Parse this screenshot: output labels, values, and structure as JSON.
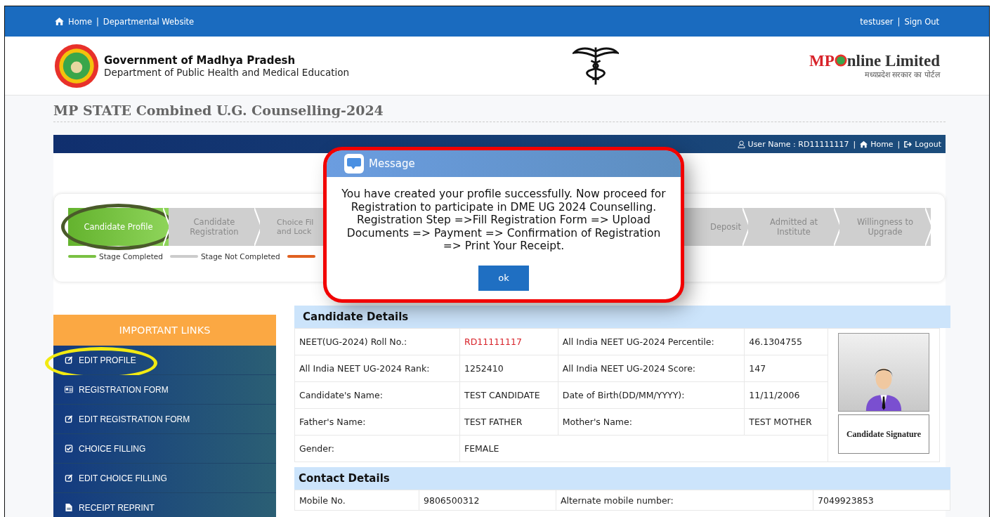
{
  "top_bar": {
    "left_links": [
      "Home",
      "Departmental Website"
    ],
    "right_links": [
      "testuser",
      "Sign Out"
    ],
    "separator": "|"
  },
  "header": {
    "org_name": "Government of Madhya Pradesh",
    "dept_name": "Department of Public Health and Medical Education",
    "brand": "MP",
    "brand_rest": "nline Limited",
    "brand_hindi": "मध्यप्रदेश सरकार का पोर्टल"
  },
  "page_title": "MP STATE Combined U.G. Counselling-2024",
  "user_bar": {
    "user_label": "User Name : RD11111117",
    "home": "Home",
    "logout": "Logout",
    "separator": "|"
  },
  "progress": {
    "steps": [
      {
        "label": "Candidate Profile",
        "completed": true,
        "highlighted": true
      },
      {
        "label": "Candidate Registration",
        "completed": false,
        "highlighted": false
      },
      {
        "label": "Choice Fil and Lock",
        "completed": false,
        "highlighted": false
      },
      {
        "label": "Deposit",
        "completed": false,
        "highlighted": false
      },
      {
        "label": "Admitted at Institute",
        "completed": false,
        "highlighted": false
      },
      {
        "label": "Willingness to Upgrade",
        "completed": false,
        "highlighted": false
      }
    ],
    "legend": [
      {
        "label": "Stage Completed",
        "color": "#7ac143"
      },
      {
        "label": "Stage Not Completed",
        "color": "#cccccc"
      },
      {
        "color": "#e06020"
      }
    ]
  },
  "sidebar": {
    "title": "IMPORTANT LINKS",
    "items": [
      {
        "label": "EDIT PROFILE",
        "kind": "edit",
        "highlighted": true
      },
      {
        "label": "REGISTRATION FORM",
        "kind": "card",
        "highlighted": false
      },
      {
        "label": "EDIT REGISTRATION FORM",
        "kind": "edit",
        "highlighted": false
      },
      {
        "label": "CHOICE FILLING",
        "kind": "check",
        "highlighted": false
      },
      {
        "label": "EDIT CHOICE FILLING",
        "kind": "edit",
        "highlighted": false
      },
      {
        "label": "RECEIPT REPRINT",
        "kind": "file",
        "highlighted": false
      }
    ]
  },
  "candidate_details": {
    "title": "Candidate Details",
    "rows": [
      [
        {
          "label": "NEET(UG-2024) Roll No.:",
          "value": "RD11111117",
          "emphasis": true
        },
        {
          "label": "All India NEET UG-2024 Percentile:",
          "value": "46.1304755",
          "emphasis": false
        }
      ],
      [
        {
          "label": "All India NEET UG-2024 Rank:",
          "value": "1252410",
          "emphasis": false
        },
        {
          "label": "All India NEET UG-2024 Score:",
          "value": "147",
          "emphasis": false
        }
      ],
      [
        {
          "label": "Candidate's Name:",
          "value": "TEST CANDIDATE",
          "emphasis": false
        },
        {
          "label": "Date of Birth(DD/MM/YYYY):",
          "value": "11/11/2006",
          "emphasis": false
        }
      ],
      [
        {
          "label": "Father's Name:",
          "value": "TEST FATHER",
          "emphasis": false
        },
        {
          "label": "Mother's Name:",
          "value": "TEST MOTHER",
          "emphasis": false
        }
      ],
      [
        {
          "label": "Gender:",
          "value": "FEMALE",
          "emphasis": false
        }
      ]
    ],
    "signature_label": "Candidate Signature"
  },
  "contact_details": {
    "title": "Contact Details",
    "rows": [
      [
        {
          "label": "Mobile No.",
          "value": "9806500312"
        },
        {
          "label": "Alternate mobile number:",
          "value": "7049923853"
        }
      ]
    ]
  },
  "modal": {
    "title": "Message",
    "body": "You have created your profile successfully. Now proceed for Registration to participate in DME UG 2024 Counselling. Registration Step =>Fill Registration Form => Upload Documents => Payment => Confirmation of Registration => Print Your Receipt.",
    "ok": "ok",
    "highlighted": true
  }
}
